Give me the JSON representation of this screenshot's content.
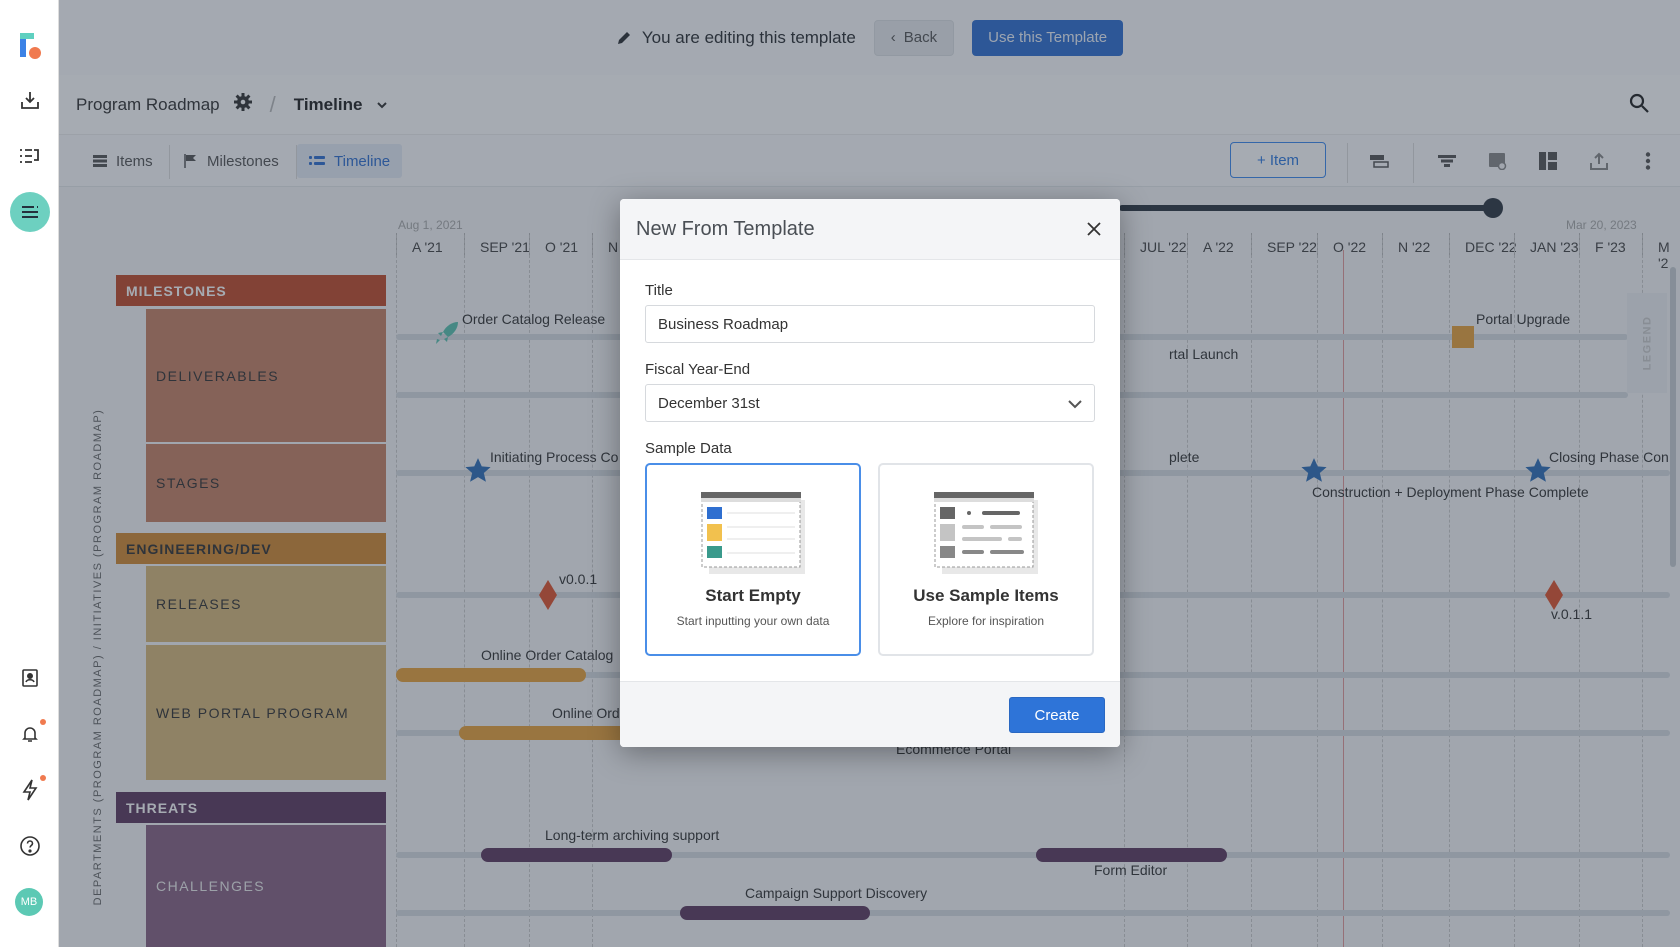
{
  "banner": {
    "message": "You are editing this template",
    "back_label": "Back",
    "use_template_label": "Use this Template"
  },
  "header": {
    "project": "Program Roadmap",
    "separator": "/",
    "view": "Timeline"
  },
  "tabs": [
    {
      "label": "Items",
      "icon": "list-icon"
    },
    {
      "label": "Milestones",
      "icon": "flag-icon"
    },
    {
      "label": "Timeline",
      "icon": "timeline-icon",
      "active": true
    }
  ],
  "toolbar": {
    "add_item_label": "+ Item",
    "tools": [
      "item-height-icon",
      "filter-icon",
      "linked-items-icon",
      "layout-icon",
      "export-icon",
      "more-icon"
    ]
  },
  "rail": {
    "icons": [
      "logo",
      "inbox-download-icon",
      "list-undo-icon",
      "roadmap-icon",
      "contacts-icon",
      "bell-icon",
      "lightning-icon",
      "help-icon"
    ],
    "avatar_initials": "MB"
  },
  "timeline": {
    "start_caption": "Aug 1, 2021",
    "end_caption": "Mar 20, 2023",
    "months": [
      "A '21",
      "SEP '21",
      "O '21",
      "N",
      "JUL '22",
      "A '22",
      "SEP '22",
      "O '22",
      "N '22",
      "DEC '22",
      "JAN '23",
      "F '23",
      "M '2"
    ],
    "vertical_label": "DEPARTMENTS (PROGRAM ROADMAP) / INITIATIVES (PROGRAM ROADMAP)",
    "legend_label": "LEGEND",
    "groups": [
      {
        "name": "MILESTONES",
        "color": "#c24a2a",
        "subs": [
          {
            "name": "DELIVERABLES",
            "color": "#c78164"
          },
          {
            "name": "STAGES",
            "color": "#c78164"
          }
        ]
      },
      {
        "name": "ENGINEERING/DEV",
        "color": "#d38a32",
        "subs": [
          {
            "name": "RELEASES",
            "color": "#d8b87a"
          },
          {
            "name": "WEB PORTAL PROGRAM",
            "color": "#d8b87a"
          }
        ]
      },
      {
        "name": "THREATS",
        "color": "#5e3a5f",
        "subs": [
          {
            "name": "CHALLENGES",
            "color": "#886383"
          }
        ]
      }
    ],
    "items": {
      "order_catalog_release": "Order Catalog Release",
      "portal_launch": "rtal Launch",
      "portal_upgrade": "Portal Upgrade",
      "initiating": "Initiating Process Co",
      "plete": "plete",
      "construction": "Construction + Deployment Phase Complete",
      "closing": "Closing Phase Con",
      "v001": "v0.0.1",
      "v011": "v.0.1.1",
      "online_order_catalog": "Online Order Catalog",
      "online_order_entry": "Online Order Entry",
      "ecommerce_portal": "Ecommerce Portal",
      "long_term": "Long-term archiving support",
      "form_editor": "Form Editor",
      "campaign": "Campaign Support Discovery"
    }
  },
  "modal": {
    "title": "New From Template",
    "title_label": "Title",
    "title_value": "Business Roadmap",
    "fiscal_label": "Fiscal Year-End",
    "fiscal_value": "December 31st",
    "sample_label": "Sample Data",
    "options": [
      {
        "title": "Start Empty",
        "subtitle": "Start inputting your own data",
        "selected": true
      },
      {
        "title": "Use Sample Items",
        "subtitle": "Explore for inspiration",
        "selected": false
      }
    ],
    "create_label": "Create"
  }
}
